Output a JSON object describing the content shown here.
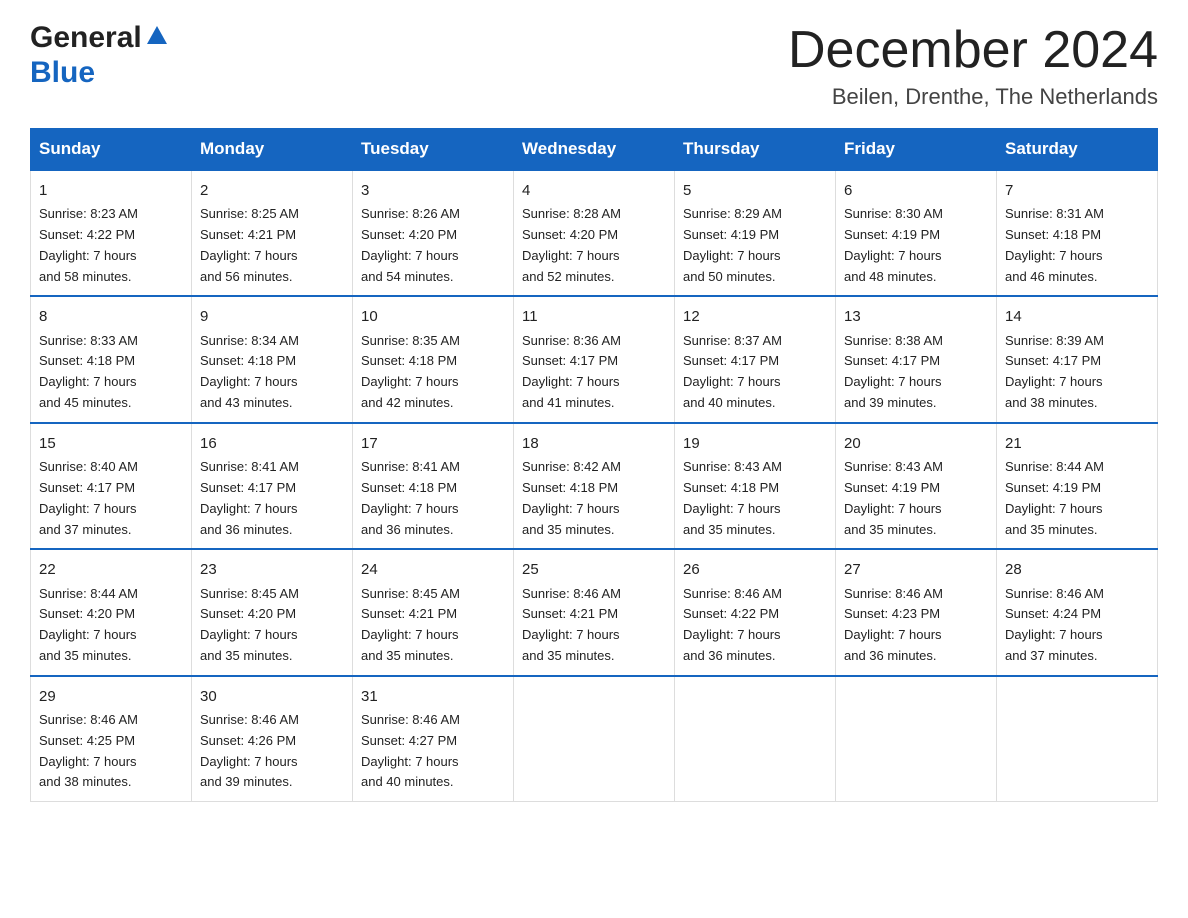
{
  "logo": {
    "line1": "General",
    "line2": "Blue"
  },
  "title": "December 2024",
  "subtitle": "Beilen, Drenthe, The Netherlands",
  "days_of_week": [
    "Sunday",
    "Monday",
    "Tuesday",
    "Wednesday",
    "Thursday",
    "Friday",
    "Saturday"
  ],
  "weeks": [
    [
      {
        "day": "1",
        "sunrise": "8:23 AM",
        "sunset": "4:22 PM",
        "daylight": "7 hours and 58 minutes."
      },
      {
        "day": "2",
        "sunrise": "8:25 AM",
        "sunset": "4:21 PM",
        "daylight": "7 hours and 56 minutes."
      },
      {
        "day": "3",
        "sunrise": "8:26 AM",
        "sunset": "4:20 PM",
        "daylight": "7 hours and 54 minutes."
      },
      {
        "day": "4",
        "sunrise": "8:28 AM",
        "sunset": "4:20 PM",
        "daylight": "7 hours and 52 minutes."
      },
      {
        "day": "5",
        "sunrise": "8:29 AM",
        "sunset": "4:19 PM",
        "daylight": "7 hours and 50 minutes."
      },
      {
        "day": "6",
        "sunrise": "8:30 AM",
        "sunset": "4:19 PM",
        "daylight": "7 hours and 48 minutes."
      },
      {
        "day": "7",
        "sunrise": "8:31 AM",
        "sunset": "4:18 PM",
        "daylight": "7 hours and 46 minutes."
      }
    ],
    [
      {
        "day": "8",
        "sunrise": "8:33 AM",
        "sunset": "4:18 PM",
        "daylight": "7 hours and 45 minutes."
      },
      {
        "day": "9",
        "sunrise": "8:34 AM",
        "sunset": "4:18 PM",
        "daylight": "7 hours and 43 minutes."
      },
      {
        "day": "10",
        "sunrise": "8:35 AM",
        "sunset": "4:18 PM",
        "daylight": "7 hours and 42 minutes."
      },
      {
        "day": "11",
        "sunrise": "8:36 AM",
        "sunset": "4:17 PM",
        "daylight": "7 hours and 41 minutes."
      },
      {
        "day": "12",
        "sunrise": "8:37 AM",
        "sunset": "4:17 PM",
        "daylight": "7 hours and 40 minutes."
      },
      {
        "day": "13",
        "sunrise": "8:38 AM",
        "sunset": "4:17 PM",
        "daylight": "7 hours and 39 minutes."
      },
      {
        "day": "14",
        "sunrise": "8:39 AM",
        "sunset": "4:17 PM",
        "daylight": "7 hours and 38 minutes."
      }
    ],
    [
      {
        "day": "15",
        "sunrise": "8:40 AM",
        "sunset": "4:17 PM",
        "daylight": "7 hours and 37 minutes."
      },
      {
        "day": "16",
        "sunrise": "8:41 AM",
        "sunset": "4:17 PM",
        "daylight": "7 hours and 36 minutes."
      },
      {
        "day": "17",
        "sunrise": "8:41 AM",
        "sunset": "4:18 PM",
        "daylight": "7 hours and 36 minutes."
      },
      {
        "day": "18",
        "sunrise": "8:42 AM",
        "sunset": "4:18 PM",
        "daylight": "7 hours and 35 minutes."
      },
      {
        "day": "19",
        "sunrise": "8:43 AM",
        "sunset": "4:18 PM",
        "daylight": "7 hours and 35 minutes."
      },
      {
        "day": "20",
        "sunrise": "8:43 AM",
        "sunset": "4:19 PM",
        "daylight": "7 hours and 35 minutes."
      },
      {
        "day": "21",
        "sunrise": "8:44 AM",
        "sunset": "4:19 PM",
        "daylight": "7 hours and 35 minutes."
      }
    ],
    [
      {
        "day": "22",
        "sunrise": "8:44 AM",
        "sunset": "4:20 PM",
        "daylight": "7 hours and 35 minutes."
      },
      {
        "day": "23",
        "sunrise": "8:45 AM",
        "sunset": "4:20 PM",
        "daylight": "7 hours and 35 minutes."
      },
      {
        "day": "24",
        "sunrise": "8:45 AM",
        "sunset": "4:21 PM",
        "daylight": "7 hours and 35 minutes."
      },
      {
        "day": "25",
        "sunrise": "8:46 AM",
        "sunset": "4:21 PM",
        "daylight": "7 hours and 35 minutes."
      },
      {
        "day": "26",
        "sunrise": "8:46 AM",
        "sunset": "4:22 PM",
        "daylight": "7 hours and 36 minutes."
      },
      {
        "day": "27",
        "sunrise": "8:46 AM",
        "sunset": "4:23 PM",
        "daylight": "7 hours and 36 minutes."
      },
      {
        "day": "28",
        "sunrise": "8:46 AM",
        "sunset": "4:24 PM",
        "daylight": "7 hours and 37 minutes."
      }
    ],
    [
      {
        "day": "29",
        "sunrise": "8:46 AM",
        "sunset": "4:25 PM",
        "daylight": "7 hours and 38 minutes."
      },
      {
        "day": "30",
        "sunrise": "8:46 AM",
        "sunset": "4:26 PM",
        "daylight": "7 hours and 39 minutes."
      },
      {
        "day": "31",
        "sunrise": "8:46 AM",
        "sunset": "4:27 PM",
        "daylight": "7 hours and 40 minutes."
      },
      null,
      null,
      null,
      null
    ]
  ],
  "labels": {
    "sunrise": "Sunrise:",
    "sunset": "Sunset:",
    "daylight": "Daylight: 7 hours"
  }
}
